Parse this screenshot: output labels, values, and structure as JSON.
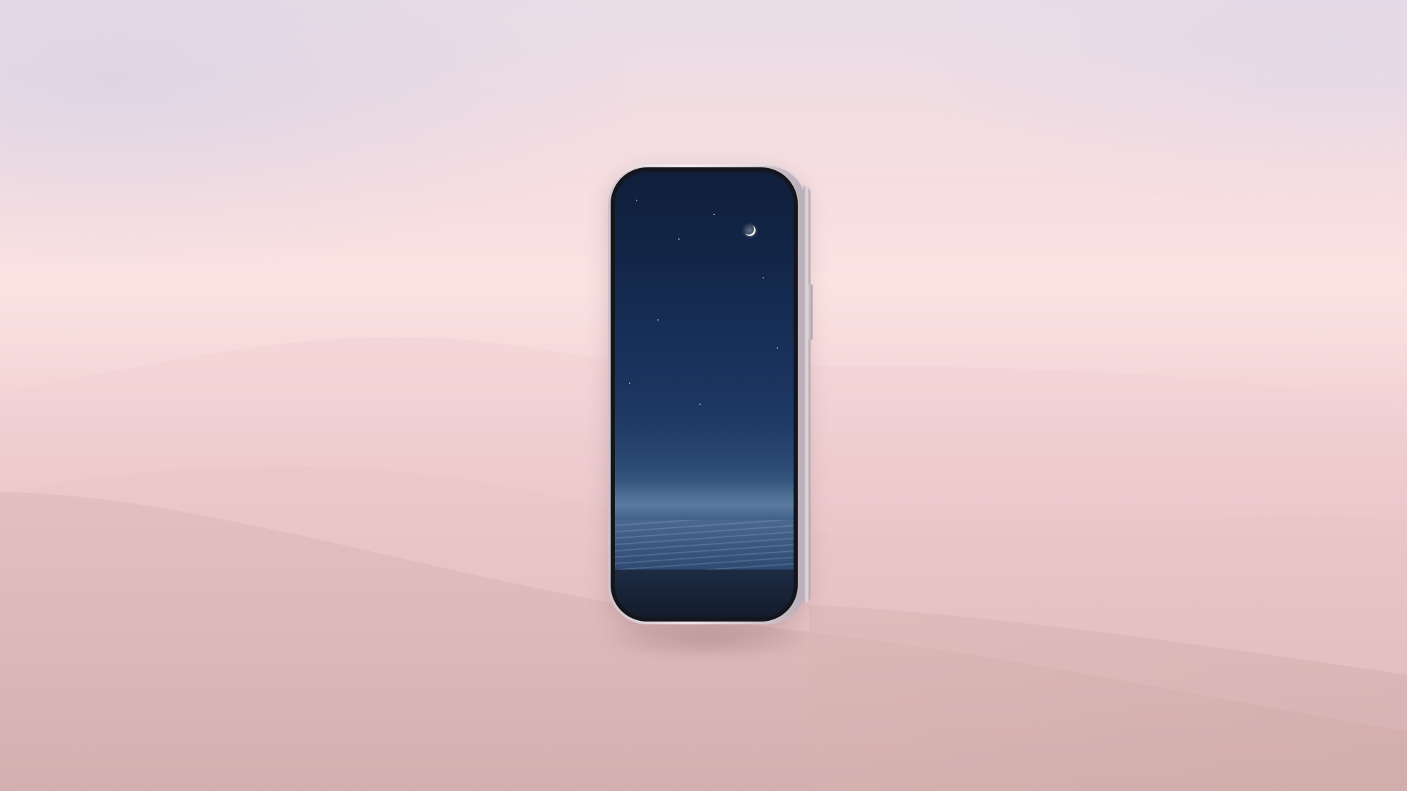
{
  "scene": {
    "colors": {
      "sky_top": "#e9dde6",
      "haze_pink": "#fbe3e2",
      "dune": "#dcb9ba",
      "phone_frame": "#e6dbe2",
      "screen_night": "#13274a",
      "sea": "#4a6890"
    },
    "icons": {
      "moon": "crescent-moon-icon"
    }
  }
}
